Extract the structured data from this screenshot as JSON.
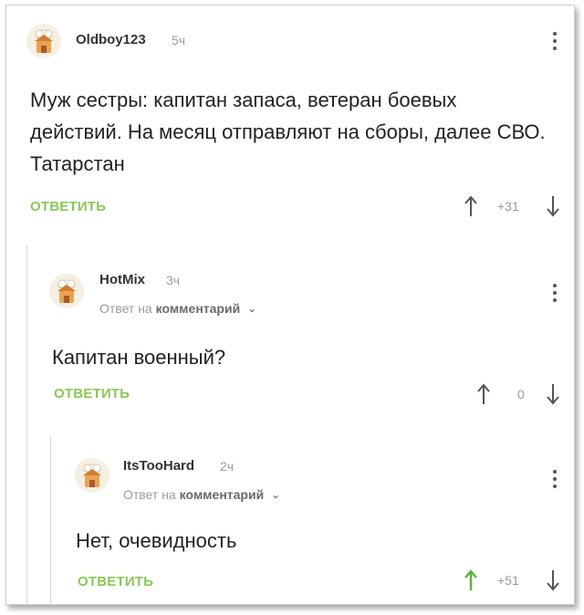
{
  "comments": [
    {
      "username": "Oldboy123",
      "time": "5ч",
      "text": "Муж сестры: капитан запаса, ветеран боевых действий. На месяц отправляют на сборы, далее СВО. Татарстан",
      "reply_label": "ОТВЕТИТЬ",
      "rating": "+31",
      "upvoted": false
    },
    {
      "username": "HotMix",
      "time": "3ч",
      "reply_to_prefix": "Ответ на",
      "reply_to_link": "комментарий",
      "text": "Капитан военный?",
      "reply_label": "ОТВЕТИТЬ",
      "rating": "0",
      "upvoted": false
    },
    {
      "username": "ItsTooHard",
      "time": "2ч",
      "reply_to_prefix": "Ответ на",
      "reply_to_link": "комментарий",
      "text": "Нет, очевидность",
      "reply_label": "ОТВЕТИТЬ",
      "rating": "+51",
      "upvoted": true
    }
  ],
  "icons": {
    "avatar": "chef-house-avatar-icon",
    "menu": "vertical-dots-menu-icon",
    "upvote": "arrow-up-icon",
    "downvote": "arrow-down-icon",
    "chevron": "chevron-down-icon"
  },
  "colors": {
    "reply_green": "#8ac858",
    "upvoted_green": "#5bb040",
    "muted_gray": "#9b9b9b",
    "text": "#222222"
  }
}
